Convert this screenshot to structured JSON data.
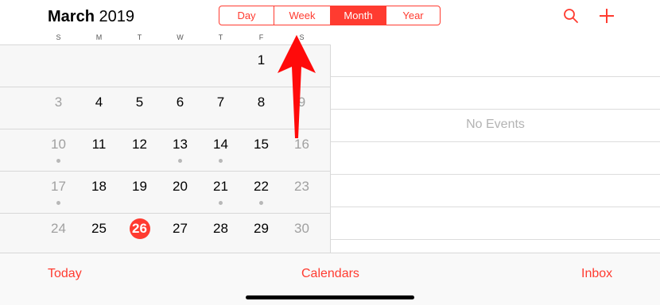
{
  "header": {
    "month": "March",
    "year": "2019",
    "view_segments": [
      {
        "label": "Day",
        "active": false
      },
      {
        "label": "Week",
        "active": false
      },
      {
        "label": "Month",
        "active": true
      },
      {
        "label": "Year",
        "active": false
      }
    ],
    "icons": [
      "search-icon",
      "add-icon"
    ]
  },
  "weekdays": [
    "S",
    "M",
    "T",
    "W",
    "T",
    "F",
    "S"
  ],
  "calendar": {
    "weeks": [
      [
        {
          "n": "",
          "dim": false,
          "dot": false
        },
        {
          "n": "",
          "dim": false,
          "dot": false
        },
        {
          "n": "",
          "dim": false,
          "dot": false
        },
        {
          "n": "",
          "dim": false,
          "dot": false
        },
        {
          "n": "",
          "dim": false,
          "dot": false
        },
        {
          "n": "1",
          "dim": false,
          "dot": false
        },
        {
          "n": "2",
          "dim": true,
          "dot": false
        }
      ],
      [
        {
          "n": "3",
          "dim": true,
          "dot": false
        },
        {
          "n": "4",
          "dim": false,
          "dot": false
        },
        {
          "n": "5",
          "dim": false,
          "dot": false
        },
        {
          "n": "6",
          "dim": false,
          "dot": false
        },
        {
          "n": "7",
          "dim": false,
          "dot": false
        },
        {
          "n": "8",
          "dim": false,
          "dot": false
        },
        {
          "n": "9",
          "dim": true,
          "dot": false
        }
      ],
      [
        {
          "n": "10",
          "dim": true,
          "dot": true
        },
        {
          "n": "11",
          "dim": false,
          "dot": false
        },
        {
          "n": "12",
          "dim": false,
          "dot": false
        },
        {
          "n": "13",
          "dim": false,
          "dot": true
        },
        {
          "n": "14",
          "dim": false,
          "dot": true
        },
        {
          "n": "15",
          "dim": false,
          "dot": false
        },
        {
          "n": "16",
          "dim": true,
          "dot": false
        }
      ],
      [
        {
          "n": "17",
          "dim": true,
          "dot": true
        },
        {
          "n": "18",
          "dim": false,
          "dot": false
        },
        {
          "n": "19",
          "dim": false,
          "dot": false
        },
        {
          "n": "20",
          "dim": false,
          "dot": false
        },
        {
          "n": "21",
          "dim": false,
          "dot": true
        },
        {
          "n": "22",
          "dim": false,
          "dot": true
        },
        {
          "n": "23",
          "dim": true,
          "dot": false
        }
      ],
      [
        {
          "n": "24",
          "dim": true,
          "dot": false
        },
        {
          "n": "25",
          "dim": false,
          "dot": false
        },
        {
          "n": "26",
          "dim": false,
          "dot": false,
          "today": true
        },
        {
          "n": "27",
          "dim": false,
          "dot": false
        },
        {
          "n": "28",
          "dim": false,
          "dot": false
        },
        {
          "n": "29",
          "dim": false,
          "dot": false
        },
        {
          "n": "30",
          "dim": true,
          "dot": false
        }
      ]
    ]
  },
  "events": {
    "empty_text": "No Events"
  },
  "tabbar": {
    "today": "Today",
    "calendars": "Calendars",
    "inbox": "Inbox"
  },
  "colors": {
    "accent": "#ff3b30",
    "dim_text": "#a0a0a0",
    "dot": "#b8b8b8"
  }
}
